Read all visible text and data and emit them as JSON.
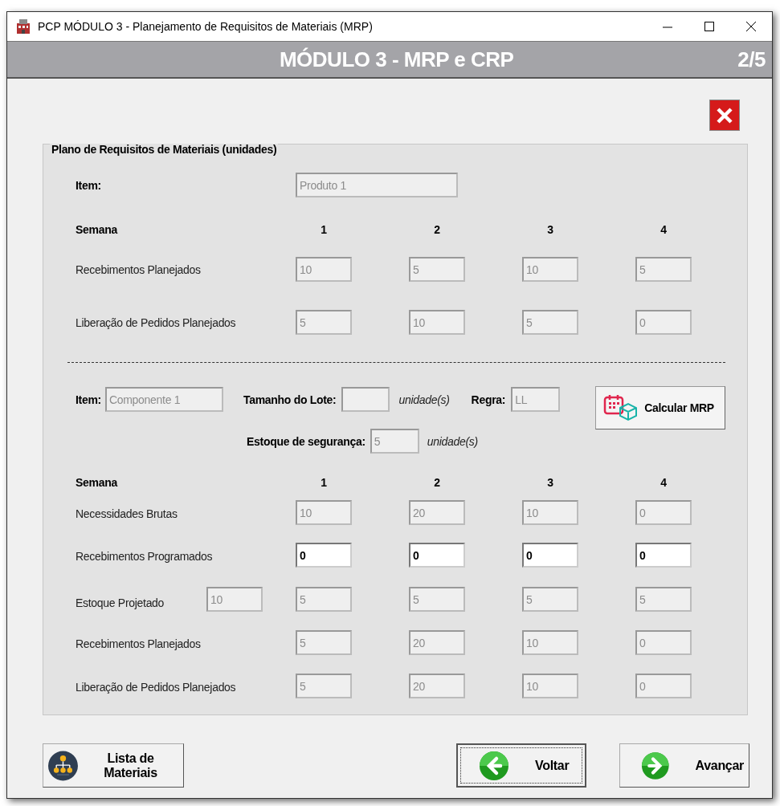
{
  "window": {
    "title": "PCP MÓDULO 3 - Planejamento de Requisitos de Materiais (MRP)"
  },
  "header": {
    "title": "MÓDULO 3 - MRP e CRP",
    "page": "2/5"
  },
  "group": {
    "title": "Plano de Requisitos de Materiais (unidades)",
    "parent": {
      "item_label": "Item:",
      "item": {
        "value": "Produto 1",
        "disabled": true
      },
      "week_label": "Semana",
      "weeks": [
        "1",
        "2",
        "3",
        "4"
      ],
      "rows": [
        {
          "label": "Recebimentos Planejados",
          "cells": [
            {
              "value": "10",
              "disabled": true
            },
            {
              "value": "5",
              "disabled": true
            },
            {
              "value": "10",
              "disabled": true
            },
            {
              "value": "5",
              "disabled": true
            }
          ]
        },
        {
          "label": "Liberação de Pedidos Planejados",
          "cells": [
            {
              "value": "5",
              "disabled": true
            },
            {
              "value": "10",
              "disabled": true
            },
            {
              "value": "5",
              "disabled": true
            },
            {
              "value": "0",
              "disabled": true
            }
          ]
        }
      ]
    },
    "component": {
      "item_label": "Item:",
      "item": {
        "value": "Componente 1",
        "disabled": true
      },
      "lot_label": "Tamanho do Lote:",
      "lot": {
        "disabled": true
      },
      "lot_unit": "unidade(s)",
      "rule_label": "Regra:",
      "rule": {
        "value": "LL",
        "disabled": true
      },
      "calc_button": "Calcular MRP",
      "safety_label": "Estoque de segurança:",
      "safety": {
        "value": "5",
        "disabled": true
      },
      "safety_unit": "unidade(s)",
      "week_label": "Semana",
      "weeks": [
        "1",
        "2",
        "3",
        "4"
      ],
      "rows": [
        {
          "label": "Necessidades Brutas",
          "cells": [
            {
              "value": "10",
              "disabled": true
            },
            {
              "value": "20",
              "disabled": true
            },
            {
              "value": "10",
              "disabled": true
            },
            {
              "value": "0",
              "disabled": true
            }
          ]
        },
        {
          "label": "Recebimentos Programados",
          "cells": [
            {
              "value": "0",
              "disabled": false
            },
            {
              "value": "0",
              "disabled": false
            },
            {
              "value": "0",
              "disabled": false
            },
            {
              "value": "0",
              "disabled": false
            }
          ]
        },
        {
          "label": "Estoque Projetado",
          "initial": {
            "value": "10",
            "disabled": true
          },
          "cells": [
            {
              "value": "5",
              "disabled": true
            },
            {
              "value": "5",
              "disabled": true
            },
            {
              "value": "5",
              "disabled": true
            },
            {
              "value": "5",
              "disabled": true
            }
          ]
        },
        {
          "label": "Recebimentos Planejados",
          "cells": [
            {
              "value": "5",
              "disabled": true
            },
            {
              "value": "20",
              "disabled": true
            },
            {
              "value": "10",
              "disabled": true
            },
            {
              "value": "0",
              "disabled": true
            }
          ]
        },
        {
          "label": "Liberação de Pedidos Planejados",
          "cells": [
            {
              "value": "5",
              "disabled": true
            },
            {
              "value": "20",
              "disabled": true
            },
            {
              "value": "10",
              "disabled": true
            },
            {
              "value": "0",
              "disabled": true
            }
          ]
        }
      ]
    }
  },
  "buttons": [
    {
      "label": "Lista de Materiais",
      "kind": "tree",
      "focused": false
    },
    {
      "label": "Voltar",
      "kind": "back",
      "focused": true
    },
    {
      "label": "Avançar",
      "kind": "next",
      "focused": false
    }
  ]
}
